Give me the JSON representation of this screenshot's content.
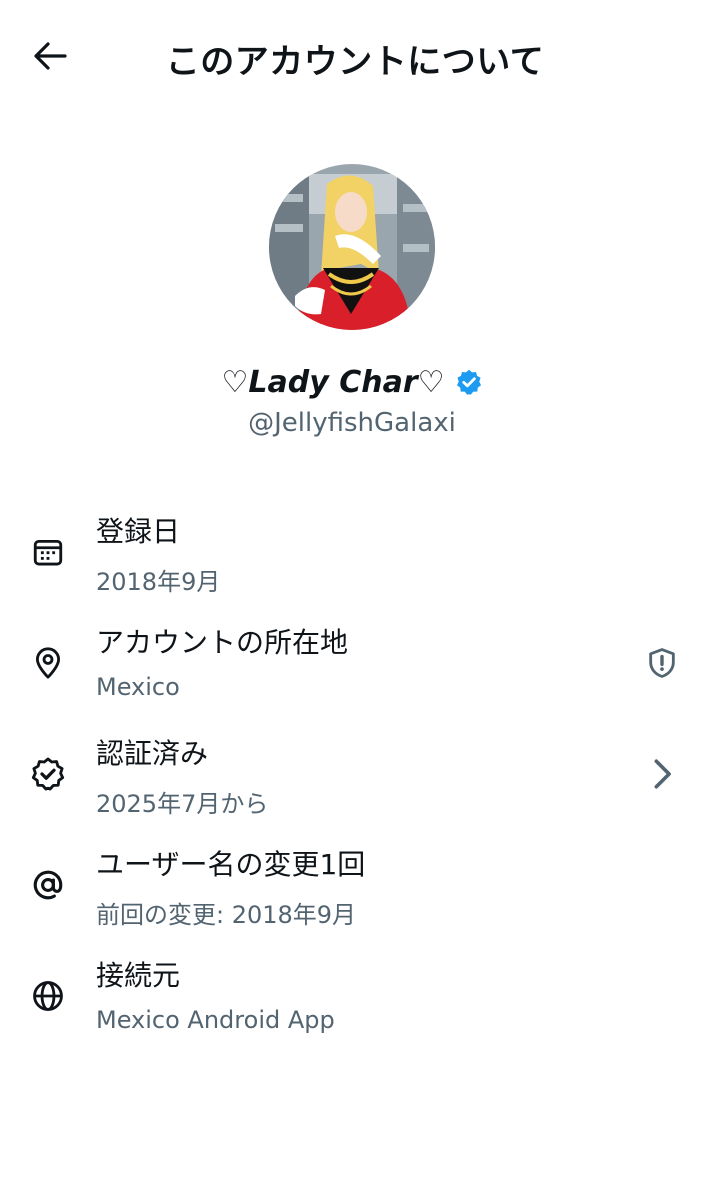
{
  "header": {
    "title": "このアカウントについて",
    "back_icon": "arrow-left-icon"
  },
  "profile": {
    "display_name_prefix": "♡ ",
    "display_name": "Lady Char",
    "display_name_suffix": " ♡",
    "handle": "@JellyfishGalaxi",
    "verified_color": "#1d9bf0"
  },
  "info": [
    {
      "label": "登録日",
      "value": "2018年9月",
      "icon": "calendar-icon"
    },
    {
      "label": "アカウントの所在地",
      "value": "Mexico",
      "icon": "location-pin-icon",
      "trail_icon": "shield-alert-icon"
    },
    {
      "label": "認証済み",
      "value": "2025年7月から",
      "icon": "verified-badge-icon",
      "trail_icon": "chevron-right-icon"
    },
    {
      "label": "ユーザー名の変更1回",
      "value": "前回の変更: 2018年9月",
      "icon": "at-sign-icon"
    },
    {
      "label": "接続元",
      "value": "Mexico Android App",
      "icon": "globe-icon"
    }
  ],
  "colors": {
    "text": "#0f1419",
    "secondary": "#536471",
    "accent": "#1d9bf0"
  }
}
